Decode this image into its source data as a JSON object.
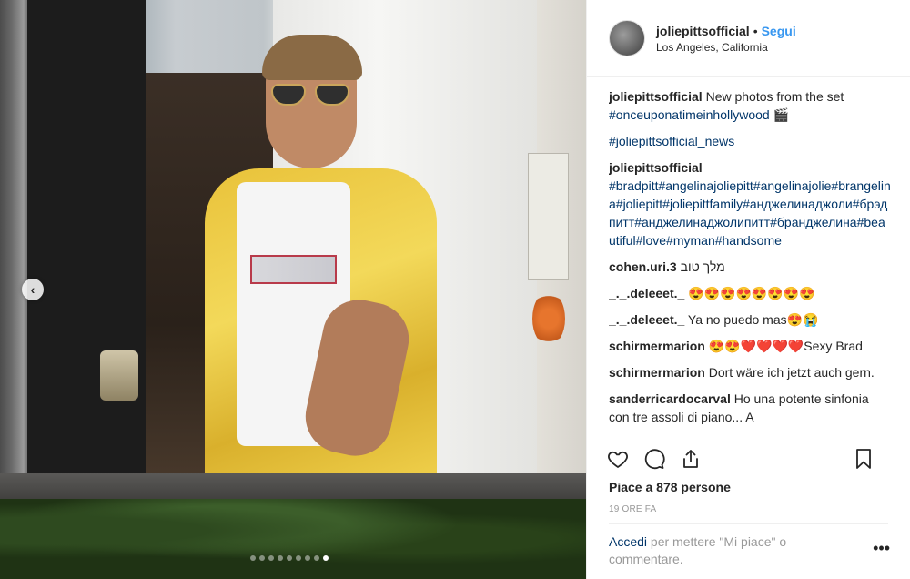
{
  "post": {
    "username": "joliepittsofficial",
    "separator": "•",
    "follow_label": "Segui",
    "location": "Los Angeles, California",
    "carousel": {
      "dots": 9,
      "active_index": 8
    }
  },
  "comments": [
    {
      "user": "joliepittsofficial",
      "text": "New photos from the set ",
      "hashtag": "#onceuponatimeinhollywood",
      "suffix": " 🎬"
    },
    {
      "user": "",
      "text": "",
      "hashtag": "#joliepittsofficial_news",
      "suffix": ""
    },
    {
      "user": "joliepittsofficial",
      "text": "",
      "hashtag": "#bradpitt#angelinajoliepitt#angelinajolie#brangelina#joliepitt#joliepittfamily#анджелинаджоли#брэдпитт#анджелинаджолипитт#бранджелина#beautiful#love#myman#handsome",
      "suffix": ""
    },
    {
      "user": "cohen.uri.3",
      "text": "מלך טוב",
      "hashtag": "",
      "suffix": ""
    },
    {
      "user": "_._.deleeet._",
      "text": "😍😍😍😍😍😍😍😍",
      "hashtag": "",
      "suffix": ""
    },
    {
      "user": "_._.deleeet._",
      "text": "Ya no puedo mas😍😭",
      "hashtag": "",
      "suffix": ""
    },
    {
      "user": "schirmermarion",
      "text": "😍😍❤️❤️❤️❤️Sexy Brad",
      "hashtag": "",
      "suffix": ""
    },
    {
      "user": "schirmermarion",
      "text": "Dort wäre ich jetzt auch gern.",
      "hashtag": "",
      "suffix": ""
    },
    {
      "user": "sanderricardocarval",
      "text": "Ho una potente sinfonia con tre assoli di piano... A",
      "hashtag": "",
      "suffix": ""
    }
  ],
  "actions": {
    "like_icon": "heart-icon",
    "comment_icon": "comment-icon",
    "share_icon": "share-icon",
    "save_icon": "bookmark-icon"
  },
  "likes_text": "Piace a 878 persone",
  "time_text": "19 ORE FA",
  "login": {
    "link": "Accedi",
    "rest": " per mettere \"Mi piace\" o commentare."
  },
  "more_label": "•••"
}
